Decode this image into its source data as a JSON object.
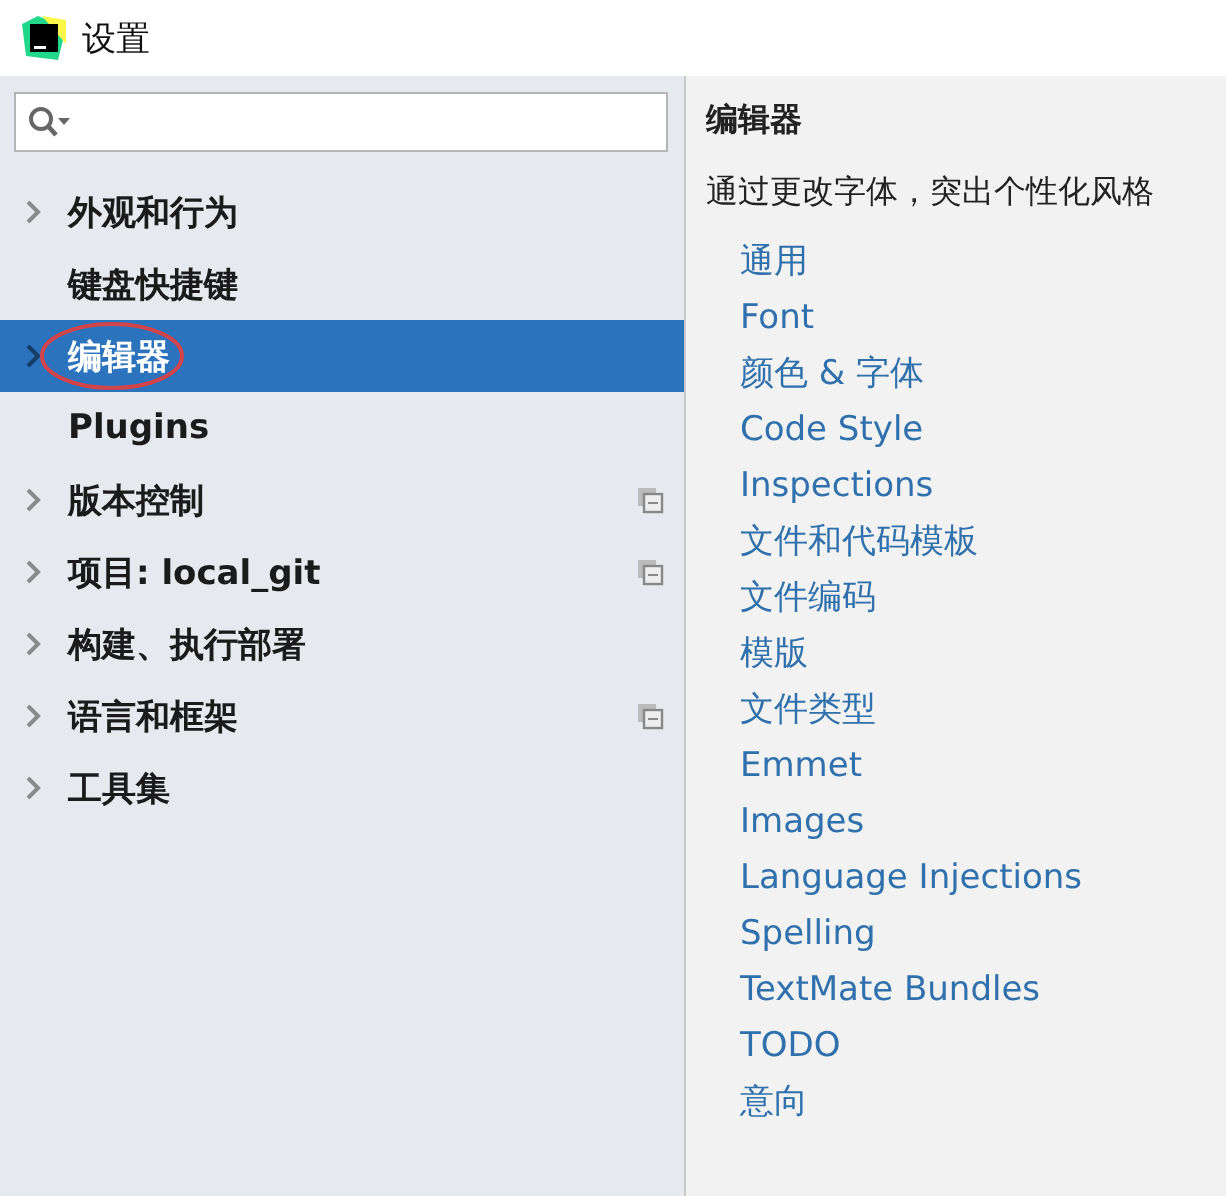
{
  "window": {
    "title": "设置"
  },
  "tree": [
    {
      "label": "外观和行为",
      "expandable": true,
      "selected": false,
      "project_icon": false,
      "annotated": false
    },
    {
      "label": "键盘快捷键",
      "expandable": false,
      "selected": false,
      "project_icon": false,
      "annotated": false
    },
    {
      "label": "编辑器",
      "expandable": true,
      "selected": true,
      "project_icon": false,
      "annotated": true
    },
    {
      "label": "Plugins",
      "expandable": false,
      "selected": false,
      "project_icon": false,
      "annotated": false
    },
    {
      "label": "版本控制",
      "expandable": true,
      "selected": false,
      "project_icon": true,
      "annotated": false
    },
    {
      "label": "项目: local_git",
      "expandable": true,
      "selected": false,
      "project_icon": true,
      "annotated": false
    },
    {
      "label": "构建、执行部署",
      "expandable": true,
      "selected": false,
      "project_icon": false,
      "annotated": false
    },
    {
      "label": "语言和框架",
      "expandable": true,
      "selected": false,
      "project_icon": true,
      "annotated": false
    },
    {
      "label": "工具集",
      "expandable": true,
      "selected": false,
      "project_icon": false,
      "annotated": false
    }
  ],
  "content": {
    "heading": "编辑器",
    "description": "通过更改字体，突出个性化风格",
    "links": [
      "通用",
      "Font",
      "颜色 & 字体",
      "Code Style",
      "Inspections",
      "文件和代码模板",
      "文件编码",
      "模版",
      "文件类型",
      "Emmet",
      "Images",
      "Language Injections",
      "Spelling",
      "TextMate Bundles",
      "TODO",
      "意向"
    ]
  }
}
